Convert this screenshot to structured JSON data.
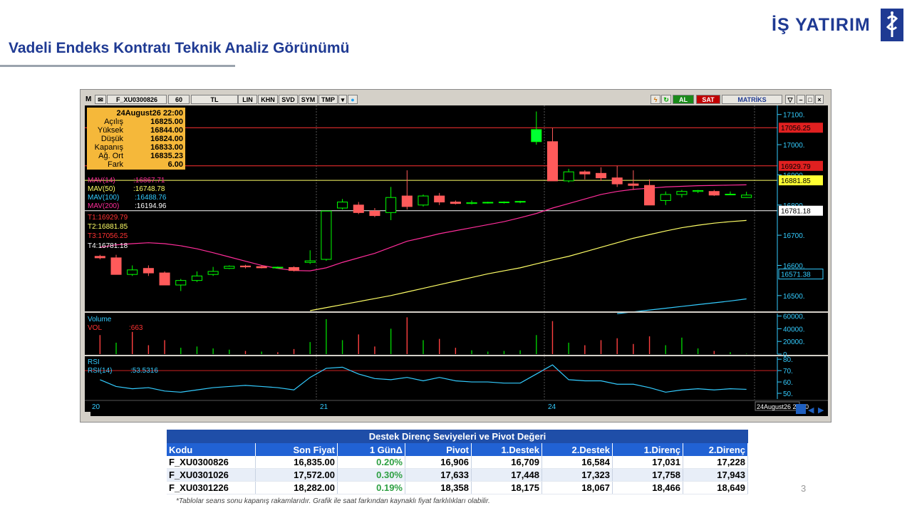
{
  "slide": {
    "title": "Vadeli Endeks Kontratı Teknik Analiz Görünümü",
    "logo_text": "İŞ YATIRIM",
    "page_number": "3",
    "note": "*Tablolar seans sonu kapanış rakamlarıdır. Grafik ile saat farkından kaynaklı fiyat farklılıkları olabilir."
  },
  "toolbar": {
    "menu_letter": "M",
    "symbol": "F_XU0300826",
    "period": "60",
    "currency": "TL",
    "buttons": [
      "LIN",
      "KHN",
      "SVD",
      "SYM",
      "TMP"
    ],
    "buy_label": "AL",
    "sell_label": "SAT",
    "brand": "MATRİKS"
  },
  "info_box": {
    "datetime": "24August26 22:00",
    "rows": [
      {
        "label": "Açılış",
        "value": "16825.00"
      },
      {
        "label": "Yüksek",
        "value": "16844.00"
      },
      {
        "label": "Düşük",
        "value": "16824.00"
      },
      {
        "label": "Kapanış",
        "value": "16833.00"
      },
      {
        "label": "Ağ. Ort",
        "value": "16835.23"
      },
      {
        "label": "Fark",
        "value": "6.00"
      }
    ]
  },
  "indicators": [
    {
      "label": "MAV(14)",
      "value": ":16867.71",
      "color": "#ff2d9a"
    },
    {
      "label": "MAV(50)",
      "value": ":16748.78",
      "color": "#ffff66"
    },
    {
      "label": "MAV(100)",
      "value": ":16488.76",
      "color": "#33ccff"
    },
    {
      "label": "MAV(200)",
      "value": ":16194.96",
      "color": "#ffffff"
    }
  ],
  "trend_lines": [
    {
      "label": "T1:16929.79",
      "color": "#ff3333"
    },
    {
      "label": "T2:16881.85",
      "color": "#ffff66"
    },
    {
      "label": "T3:17056.25",
      "color": "#ff3333"
    },
    {
      "label": "T4:16781.18",
      "color": "#ffffff"
    }
  ],
  "price_scale": {
    "ticks": [
      "17100.",
      "17000.",
      "16900.",
      "16800.",
      "16700.",
      "16600.",
      "16500."
    ],
    "tags": [
      {
        "text": "17056.25",
        "bg": "#e02020",
        "fg": "#000000"
      },
      {
        "text": "16929.79",
        "bg": "#e02020",
        "fg": "#000000"
      },
      {
        "text": "16881.85",
        "bg": "#ffff33",
        "fg": "#000000"
      },
      {
        "text": "16781.18",
        "bg": "#ffffff",
        "fg": "#000000"
      },
      {
        "text": "16571.38",
        "bg": "#000000",
        "fg": "#33ccff"
      }
    ]
  },
  "volume_panel": {
    "title": "Volume",
    "label": "VOL",
    "value": ":663",
    "ticks": [
      "60000.",
      "40000.",
      "20000.",
      "0."
    ]
  },
  "rsi_panel": {
    "title": "RSI",
    "label": "RSI(14)",
    "value": ":53.5316",
    "ticks": [
      "80.",
      "70.",
      "60.",
      "50."
    ]
  },
  "time_axis": {
    "labels": [
      "20",
      "21",
      "24"
    ],
    "cursor_label": "24August26 22:00"
  },
  "table": {
    "title": "Destek Direnç Seviyeleri ve Pivot Değeri",
    "headers": [
      "Kodu",
      "Son Fiyat",
      "1 GünΔ",
      "Pivot",
      "1.Destek",
      "2.Destek",
      "1.Direnç",
      "2.Direnç"
    ],
    "rows": [
      [
        "F_XU0300826",
        "16,835.00",
        "0.20%",
        "16,906",
        "16,709",
        "16,584",
        "17,031",
        "17,228"
      ],
      [
        "F_XU0301026",
        "17,572.00",
        "0.30%",
        "17,633",
        "17,448",
        "17,323",
        "17,758",
        "17,943"
      ],
      [
        "F_XU0301226",
        "18,282.00",
        "0.19%",
        "18,358",
        "18,175",
        "18,067",
        "18,466",
        "18,649"
      ]
    ]
  },
  "chart_data": {
    "type": "candlestick",
    "price_axis": [
      16450,
      17130
    ],
    "candles": [
      {
        "o": 16630,
        "h": 16635,
        "l": 16620,
        "c": 16625
      },
      {
        "o": 16625,
        "h": 16635,
        "l": 16570,
        "c": 16570
      },
      {
        "o": 16570,
        "h": 16600,
        "l": 16565,
        "c": 16585
      },
      {
        "o": 16590,
        "h": 16600,
        "l": 16565,
        "c": 16575
      },
      {
        "o": 16575,
        "h": 16580,
        "l": 16535,
        "c": 16535
      },
      {
        "o": 16535,
        "h": 16555,
        "l": 16515,
        "c": 16550
      },
      {
        "o": 16550,
        "h": 16580,
        "l": 16545,
        "c": 16565
      },
      {
        "o": 16570,
        "h": 16595,
        "l": 16565,
        "c": 16580
      },
      {
        "o": 16590,
        "h": 16600,
        "l": 16588,
        "c": 16597
      },
      {
        "o": 16598,
        "h": 16602,
        "l": 16590,
        "c": 16595
      },
      {
        "o": 16596,
        "h": 16600,
        "l": 16590,
        "c": 16592
      },
      {
        "o": 16593,
        "h": 16596,
        "l": 16589,
        "c": 16594
      },
      {
        "o": 16593,
        "h": 16597,
        "l": 16580,
        "c": 16583
      },
      {
        "o": 16610,
        "h": 16650,
        "l": 16605,
        "c": 16615
      },
      {
        "o": 16620,
        "h": 16755,
        "l": 16615,
        "c": 16780
      },
      {
        "o": 16790,
        "h": 16820,
        "l": 16785,
        "c": 16810
      },
      {
        "o": 16800,
        "h": 16810,
        "l": 16770,
        "c": 16775
      },
      {
        "o": 16780,
        "h": 16790,
        "l": 16760,
        "c": 16765
      },
      {
        "o": 16775,
        "h": 16860,
        "l": 16750,
        "c": 16825
      },
      {
        "o": 16830,
        "h": 16915,
        "l": 16785,
        "c": 16795
      },
      {
        "o": 16800,
        "h": 16835,
        "l": 16795,
        "c": 16830
      },
      {
        "o": 16830,
        "h": 16840,
        "l": 16800,
        "c": 16810
      },
      {
        "o": 16810,
        "h": 16815,
        "l": 16802,
        "c": 16805
      },
      {
        "o": 16805,
        "h": 16815,
        "l": 16802,
        "c": 16808
      },
      {
        "o": 16808,
        "h": 16811,
        "l": 16805,
        "c": 16809
      },
      {
        "o": 16808,
        "h": 16812,
        "l": 16805,
        "c": 16810
      },
      {
        "o": 16810,
        "h": 16814,
        "l": 16806,
        "c": 16812
      },
      {
        "o": 17010,
        "h": 17110,
        "l": 17000,
        "c": 17050
      },
      {
        "o": 17010,
        "h": 17055,
        "l": 16880,
        "c": 16880
      },
      {
        "o": 16880,
        "h": 16920,
        "l": 16875,
        "c": 16910
      },
      {
        "o": 16910,
        "h": 16915,
        "l": 16885,
        "c": 16903
      },
      {
        "o": 16905,
        "h": 16925,
        "l": 16880,
        "c": 16890
      },
      {
        "o": 16890,
        "h": 16930,
        "l": 16860,
        "c": 16870
      },
      {
        "o": 16870,
        "h": 16915,
        "l": 16850,
        "c": 16865
      },
      {
        "o": 16865,
        "h": 16885,
        "l": 16800,
        "c": 16800
      },
      {
        "o": 16815,
        "h": 16845,
        "l": 16800,
        "c": 16835
      },
      {
        "o": 16835,
        "h": 16850,
        "l": 16825,
        "c": 16845
      },
      {
        "o": 16845,
        "h": 16850,
        "l": 16840,
        "c": 16848
      },
      {
        "o": 16845,
        "h": 16850,
        "l": 16830,
        "c": 16833
      },
      {
        "o": 16835,
        "h": 16845,
        "l": 16833,
        "c": 16836
      },
      {
        "o": 16825,
        "h": 16844,
        "l": 16824,
        "c": 16833
      }
    ],
    "mav14": [
      16660,
      16668,
      16672,
      16675,
      16672,
      16665,
      16655,
      16642,
      16628,
      16614,
      16600,
      16590,
      16583,
      16582,
      16592,
      16610,
      16625,
      16640,
      16660,
      16680,
      16692,
      16705,
      16715,
      16725,
      16735,
      16745,
      16758,
      16772,
      16790,
      16805,
      16820,
      16835,
      16845,
      16852,
      16856,
      16860,
      16862,
      16864,
      16865,
      16866,
      16867
    ],
    "mav50": [
      null,
      null,
      null,
      null,
      null,
      null,
      null,
      null,
      null,
      null,
      null,
      null,
      null,
      16450,
      16460,
      16470,
      16480,
      16490,
      16500,
      16512,
      16524,
      16536,
      16548,
      16560,
      16572,
      16582,
      16592,
      16605,
      16618,
      16630,
      16645,
      16660,
      16675,
      16690,
      16702,
      16714,
      16725,
      16733,
      16740,
      16745,
      16749
    ],
    "mav100": [
      null,
      null,
      null,
      null,
      null,
      null,
      null,
      null,
      null,
      null,
      null,
      null,
      null,
      null,
      null,
      null,
      null,
      null,
      null,
      null,
      null,
      null,
      null,
      null,
      null,
      null,
      null,
      null,
      null,
      null,
      null,
      null,
      16440,
      16446,
      16452,
      16458,
      16464,
      16470,
      16476,
      16482,
      16489
    ],
    "volume": [
      {
        "v": 30000,
        "dir": "dn"
      },
      {
        "v": 18000,
        "dir": "up"
      },
      {
        "v": 35000,
        "dir": "dn"
      },
      {
        "v": 14000,
        "dir": "dn"
      },
      {
        "v": 22000,
        "dir": "dn"
      },
      {
        "v": 10000,
        "dir": "up"
      },
      {
        "v": 12000,
        "dir": "up"
      },
      {
        "v": 9000,
        "dir": "up"
      },
      {
        "v": 7000,
        "dir": "up"
      },
      {
        "v": 5000,
        "dir": "dn"
      },
      {
        "v": 4000,
        "dir": "up"
      },
      {
        "v": 3000,
        "dir": "dn"
      },
      {
        "v": 8000,
        "dir": "dn"
      },
      {
        "v": 19000,
        "dir": "up"
      },
      {
        "v": 55000,
        "dir": "up"
      },
      {
        "v": 22000,
        "dir": "up"
      },
      {
        "v": 31000,
        "dir": "dn"
      },
      {
        "v": 12000,
        "dir": "dn"
      },
      {
        "v": 40000,
        "dir": "up"
      },
      {
        "v": 58000,
        "dir": "dn"
      },
      {
        "v": 22000,
        "dir": "up"
      },
      {
        "v": 24000,
        "dir": "dn"
      },
      {
        "v": 10000,
        "dir": "dn"
      },
      {
        "v": 6000,
        "dir": "up"
      },
      {
        "v": 4000,
        "dir": "up"
      },
      {
        "v": 5000,
        "dir": "up"
      },
      {
        "v": 6000,
        "dir": "up"
      },
      {
        "v": 30000,
        "dir": "up"
      },
      {
        "v": 52000,
        "dir": "dn"
      },
      {
        "v": 18000,
        "dir": "up"
      },
      {
        "v": 14000,
        "dir": "dn"
      },
      {
        "v": 22000,
        "dir": "dn"
      },
      {
        "v": 25000,
        "dir": "dn"
      },
      {
        "v": 16000,
        "dir": "dn"
      },
      {
        "v": 28000,
        "dir": "dn"
      },
      {
        "v": 14000,
        "dir": "up"
      },
      {
        "v": 26000,
        "dir": "up"
      },
      {
        "v": 9000,
        "dir": "up"
      },
      {
        "v": 5000,
        "dir": "dn"
      },
      {
        "v": 3000,
        "dir": "up"
      },
      {
        "v": 663,
        "dir": "up"
      }
    ],
    "rsi": [
      62,
      56,
      54,
      55,
      52,
      51,
      53,
      55,
      56,
      57,
      56,
      55,
      53,
      64,
      72,
      73,
      67,
      63,
      62,
      64,
      61,
      64,
      61,
      60,
      60,
      59,
      59,
      67,
      75,
      62,
      61,
      61,
      58,
      58,
      55,
      51,
      53,
      54,
      53,
      54,
      53.5
    ],
    "rsi_axis": [
      45,
      82
    ]
  }
}
